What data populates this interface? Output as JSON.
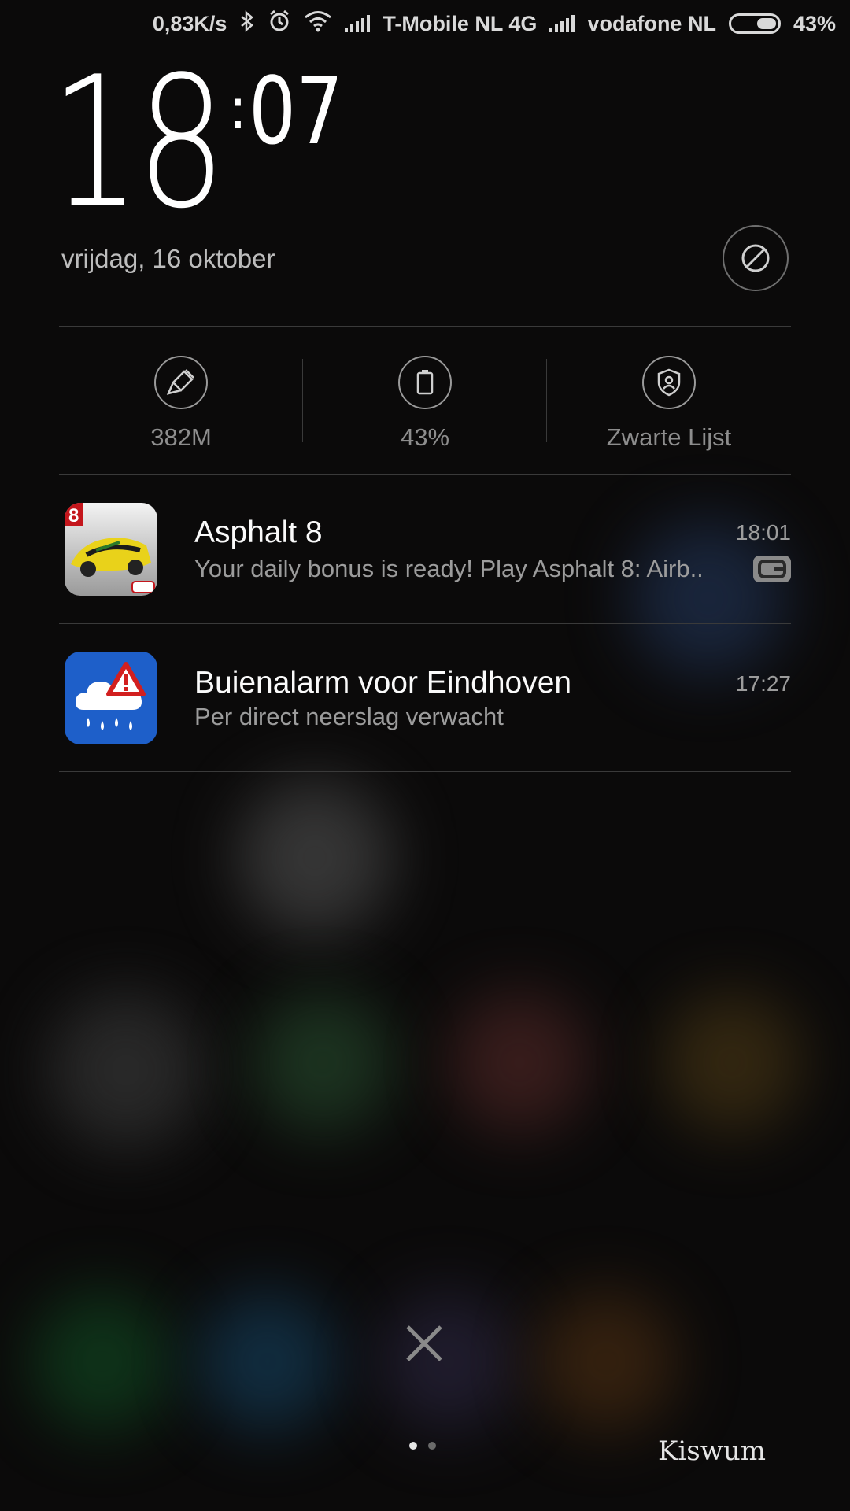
{
  "status_bar": {
    "speed": "0,83K/s",
    "carrier1": "T-Mobile  NL 4G",
    "carrier2": "vodafone NL",
    "battery": "43%",
    "icons": [
      "bluetooth-icon",
      "alarm-icon",
      "wifi-icon",
      "signal-icon",
      "signal-icon",
      "battery-icon"
    ]
  },
  "clock": {
    "hour": "18",
    "colon": ":",
    "minutes": "07"
  },
  "date": "vrijdag, 16 oktober",
  "quick_stats": [
    {
      "icon": "broom-icon",
      "label": "382M"
    },
    {
      "icon": "battery-icon",
      "label": "43%"
    },
    {
      "icon": "shield-user-icon",
      "label": "Zwarte Lijst"
    }
  ],
  "notifications": [
    {
      "app": "Asphalt 8",
      "time": "18:01",
      "body": "Your daily bonus is ready! Play Asphalt 8: Airb..",
      "icon": "asphalt-app-icon"
    },
    {
      "app": "Buienalarm voor Eindhoven",
      "time": "17:27",
      "body": "Per direct neerslag verwacht",
      "icon": "buienalarm-app-icon"
    }
  ],
  "watermark": "Kiswum",
  "colors": {
    "background": "#0b0a0a",
    "buienalarm_blue": "#1e5fc9"
  }
}
